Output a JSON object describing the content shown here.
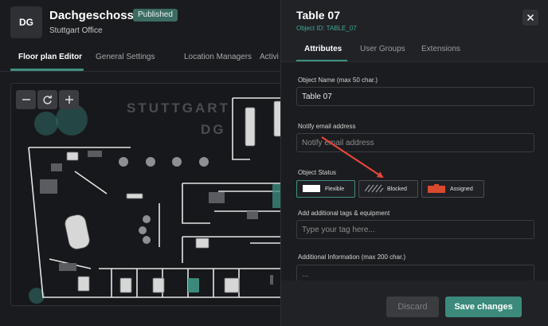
{
  "floor": {
    "avatar": "DG",
    "title": "Dachgeschoss",
    "status_badge": "Published",
    "subtitle": "Stuttgart Office",
    "tabs": [
      {
        "label": "Floor plan Editor"
      },
      {
        "label": "General Settings"
      },
      {
        "label": "Location Managers"
      },
      {
        "label": "Activi"
      }
    ]
  },
  "plan": {
    "watermark_line1": "STUTTGART",
    "watermark_line2": "DG",
    "controls": {
      "zoom_out": "zoom-out-icon",
      "reset": "reset-icon",
      "zoom_in": "zoom-in-icon"
    }
  },
  "panel": {
    "title": "Table 07",
    "object_id": "Object ID: TABLE_07",
    "tabs": [
      {
        "label": "Attributes"
      },
      {
        "label": "User Groups"
      },
      {
        "label": "Extensions"
      }
    ],
    "object_name": {
      "label": "Object Name (max 50 char.)",
      "value": "Table 07"
    },
    "notify_email": {
      "label": "Notify email address",
      "placeholder": "Notify email address"
    },
    "object_status": {
      "label": "Object Status",
      "options": [
        {
          "label": "Flexible",
          "selected": true
        },
        {
          "label": "Blocked",
          "selected": false
        },
        {
          "label": "Assigned",
          "selected": false
        }
      ]
    },
    "tags": {
      "label": "Add additional tags & equipment",
      "placeholder": "Type your tag here..."
    },
    "additional_info": {
      "label": "Additional Information (max 200 char.)",
      "placeholder": "..."
    },
    "discard": "Discard",
    "save": "Save changes"
  },
  "colors": {
    "accent": "#3f8f82",
    "object_id": "#3fa896",
    "annotation_arrow": "#e8473a",
    "assigned": "#d9492f"
  }
}
